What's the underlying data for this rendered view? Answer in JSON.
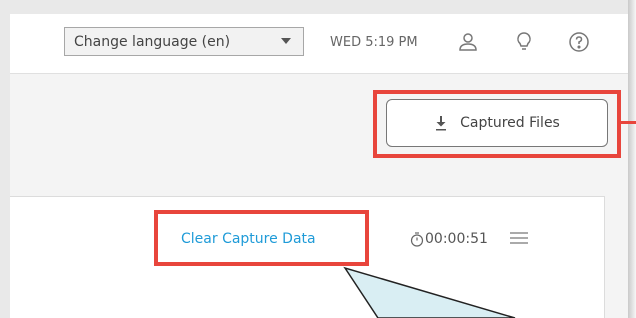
{
  "header": {
    "language_select": {
      "value": "Change language (en)"
    },
    "clock": "WED 5:19 PM",
    "icons": [
      "user-icon",
      "lightbulb-icon",
      "help-icon"
    ]
  },
  "toolbar": {
    "captured_files_label": "Captured Files",
    "captured_files_icon": "download-icon"
  },
  "capture_panel": {
    "clear_label": "Clear Capture Data",
    "timer": "00:00:51",
    "timer_icon": "stopwatch-icon",
    "menu_icon": "menu-icon"
  },
  "colors": {
    "highlight": "#e8453c",
    "link": "#1f9bd8",
    "callout_fill": "#d9eef3"
  }
}
